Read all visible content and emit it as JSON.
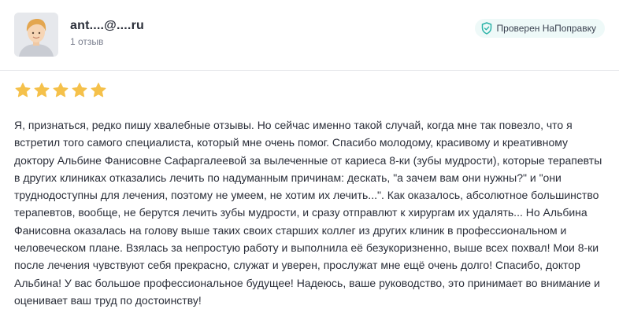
{
  "reviewer": {
    "name": "ant....@....ru",
    "review_count": "1 отзыв"
  },
  "badge": {
    "label": "Проверен НаПоправку",
    "icon": "shield-check-icon"
  },
  "rating": {
    "value": 5,
    "max": 5,
    "star_color": "#f5c14b"
  },
  "review": {
    "text": "Я, признаться, редко пишу хвалебные отзывы. Но сейчас именно такой случай, когда мне так повезло, что я встретил того самого специалиста, который мне очень помог. Спасибо молодому, красивому и креативному доктору Альбине Фанисовне Сафаргалеевой за вылеченные от кариеса 8-ки (зубы мудрости), которые терапевты в других клиниках отказались лечить по надуманным причинам: дескать, \"а зачем вам они нужны?\" и \"они труднодоступны для лечения, поэтому не умеем, не хотим их лечить...\". Как оказалось, абсолютное большинство терапевтов, вообще, не берутся лечить зубы мудрости, и сразу отправлют к хирургам их удалять... Но Альбина Фанисовна оказалась на голову выше таких своих старших коллег из других клиник в профессиональном и человеческом плане. Взялась за непростую работу и выполнила её безукоризненно, выше всех похвал! Мои 8-ки после лечения чувствуют себя прекрасно, служат и уверен, прослужат мне ещё очень долго! Спасибо, доктор Альбина! У вас большое профессиональное будущее! Надеюсь, ваше руководство, это принимает во внимание и оценивает ваш труд по достоинству!"
  },
  "colors": {
    "accent": "#2bb3a8",
    "badge_bg": "#eef9f8"
  }
}
